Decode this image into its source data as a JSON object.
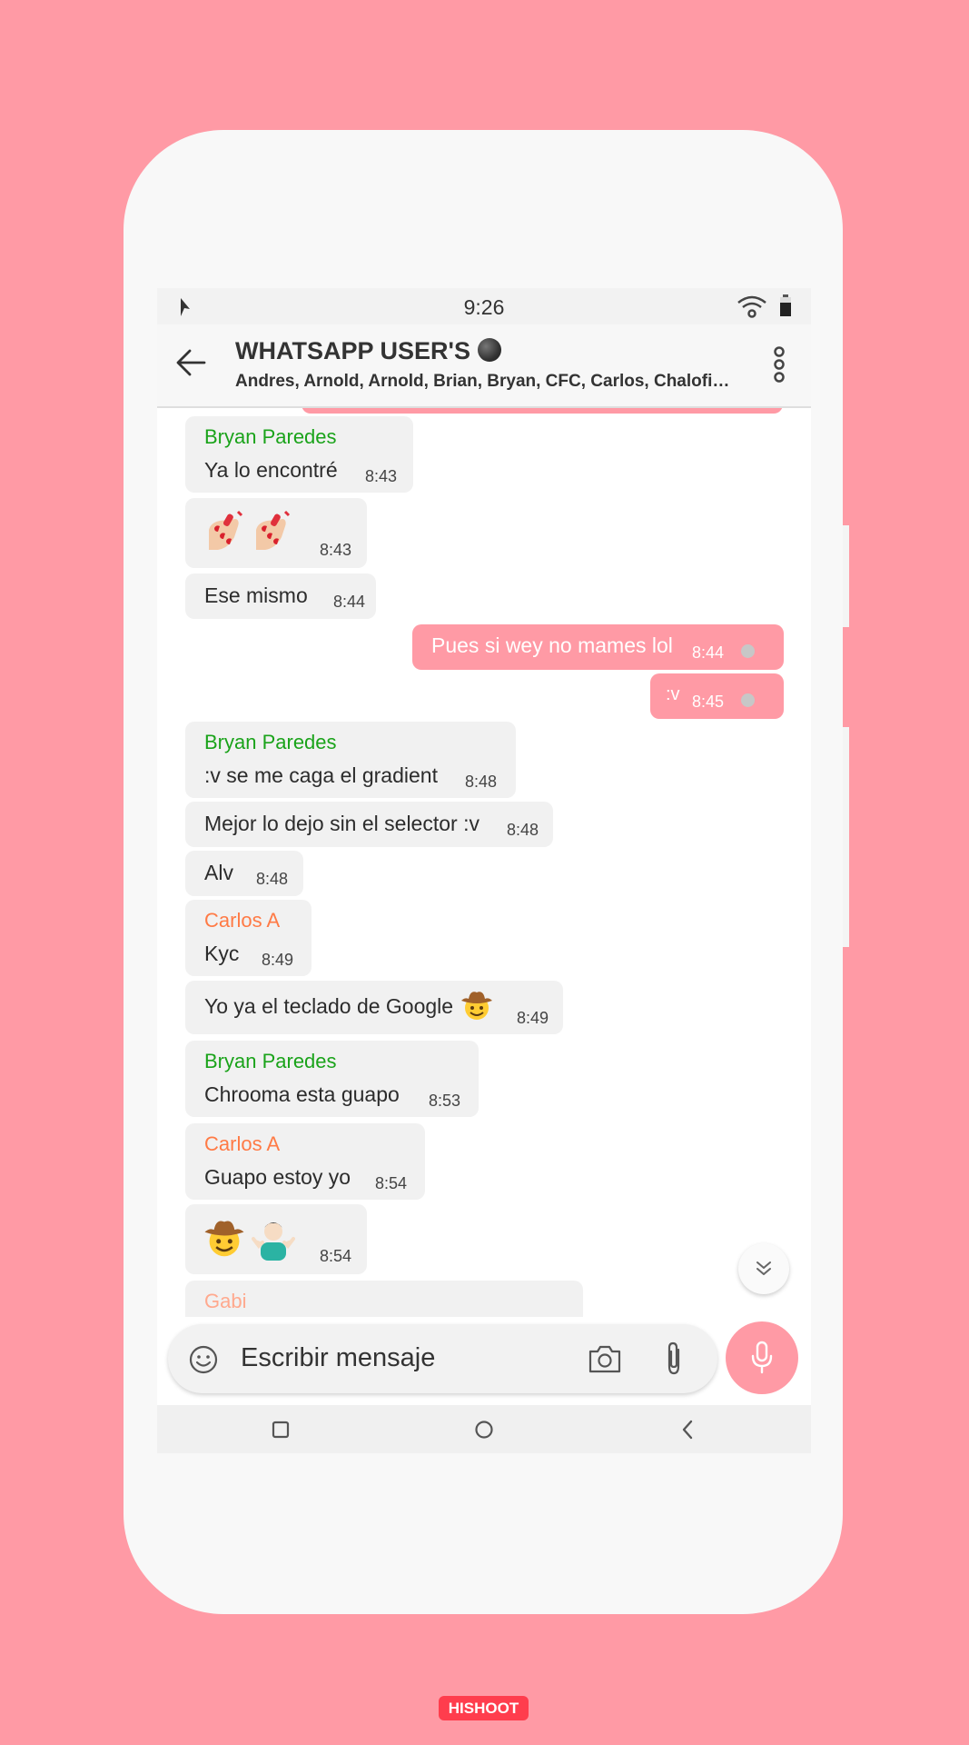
{
  "colors": {
    "accent": "#ff9aa5",
    "sender_green": "#1aa31a",
    "sender_orange": "#ff7a45",
    "sender_peach": "#ffa98e"
  },
  "status_bar": {
    "time": "9:26",
    "left_icon": "compass-icon",
    "right_icons": [
      "wifi-icon",
      "battery-icon"
    ]
  },
  "header": {
    "title": "WHATSAPP USER'S",
    "title_emoji": "black-ball-emoji",
    "subtitle": "Andres, Arnold, Arnold, Brian, Bryan, CFC, Carlos, Chalofi…"
  },
  "messages": [
    {
      "dir": "in",
      "sender": "Bryan Paredes",
      "text": "Ya lo encontré",
      "time": "8:43"
    },
    {
      "dir": "in",
      "emoji": [
        "nail-polish-emoji",
        "nail-polish-emoji"
      ],
      "time": "8:43"
    },
    {
      "dir": "in",
      "text": "Ese mismo",
      "time": "8:44"
    },
    {
      "dir": "out",
      "text": "Pues si wey no mames lol",
      "time": "8:44"
    },
    {
      "dir": "out",
      "text": ":v",
      "time": "8:45"
    },
    {
      "dir": "in",
      "sender": "Bryan Paredes",
      "text": ":v se me caga el gradient",
      "time": "8:48"
    },
    {
      "dir": "in",
      "text": "Mejor lo dejo sin el selector :v",
      "time": "8:48"
    },
    {
      "dir": "in",
      "text": "Alv",
      "time": "8:48"
    },
    {
      "dir": "in",
      "sender": "Carlos A",
      "text": "Kyc",
      "time": "8:49"
    },
    {
      "dir": "in",
      "text": "Yo ya el teclado de Google",
      "emoji": [
        "cowboy-face-emoji"
      ],
      "time": "8:49"
    },
    {
      "dir": "in",
      "sender": "Bryan Paredes",
      "text": "Chrooma esta guapo",
      "time": "8:53"
    },
    {
      "dir": "in",
      "sender": "Carlos A",
      "text": "Guapo estoy yo",
      "time": "8:54"
    },
    {
      "dir": "in",
      "emoji": [
        "cowboy-face-emoji",
        "person-shrugging-emoji"
      ],
      "time": "8:54"
    },
    {
      "dir": "in",
      "sender": "Gabi"
    }
  ],
  "composer": {
    "placeholder": "Escribir mensaje",
    "icons": [
      "smiley-icon",
      "camera-icon",
      "paperclip-icon",
      "microphone-icon"
    ]
  },
  "scroll_button": {
    "icon": "double-chevron-down-icon"
  },
  "nav_bar": {
    "icons": [
      "recents-square-icon",
      "home-circle-icon",
      "back-chevron-icon"
    ]
  },
  "watermark": "HISHOOT"
}
